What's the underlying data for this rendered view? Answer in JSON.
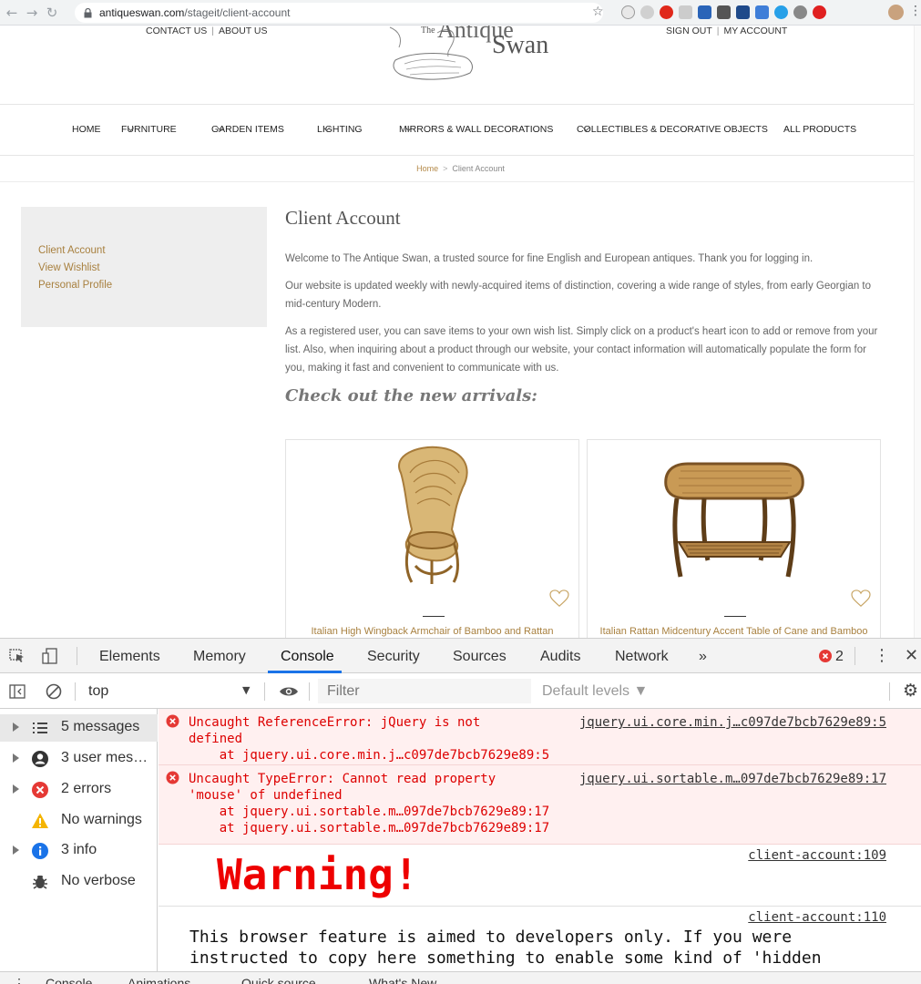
{
  "browser": {
    "url_host": "antiqueswan.com",
    "url_path": "/stageit/client-account"
  },
  "site": {
    "top_left_links": [
      "CONTACT US",
      "ABOUT US"
    ],
    "top_right_links": [
      "SIGN OUT",
      "MY ACCOUNT"
    ],
    "logo": {
      "the": "The",
      "antique": "Antique",
      "swan": "Swan"
    },
    "nav": [
      "HOME",
      "FURNITURE",
      "GARDEN ITEMS",
      "LIGHTING",
      "MIRRORS & WALL DECORATIONS",
      "COLLECTIBLES & DECORATIVE OBJECTS",
      "ALL PRODUCTS"
    ],
    "breadcrumb": {
      "home": "Home",
      "sep": ">",
      "current": "Client Account"
    },
    "sidebar": [
      "Client Account",
      "View Wishlist",
      "Personal Profile"
    ],
    "content": {
      "title": "Client Account",
      "p1": "Welcome to The Antique Swan, a trusted source for fine English and European antiques. Thank you for logging in.",
      "p2": "Our website is updated weekly with newly-acquired items of distinction, covering a wide range of styles, from early Georgian to mid-century Modern.",
      "p3": "As a registered user, you can save items to your own wish list. Simply click on a product's heart icon to add or remove from your list. Also, when inquiring about a product through our website, your contact information will automatically populate the form for you, making it fast and convenient to communicate with us.",
      "arrivals": "Check out the new arrivals:"
    },
    "products": [
      {
        "title": "Italian High Wingback Armchair of Bamboo and Rattan"
      },
      {
        "title": "Italian Rattan Midcentury Accent Table of Cane and Bamboo"
      }
    ],
    "colors": {
      "accent": "#a8803f",
      "sidebar_bg": "#eeeeee"
    }
  },
  "devtools": {
    "tabs": [
      "Elements",
      "Memory",
      "Console",
      "Security",
      "Sources",
      "Audits",
      "Network"
    ],
    "more_tabs": "»",
    "active_tab": "Console",
    "error_count": "2",
    "context": "top",
    "filter_placeholder": "Filter",
    "levels": "Default levels ▼",
    "sidebar": [
      {
        "label": "5 messages",
        "icon": "list-icon"
      },
      {
        "label": "3 user mes…",
        "icon": "user-icon"
      },
      {
        "label": "2 errors",
        "icon": "error-icon"
      },
      {
        "label": "No warnings",
        "icon": "warning-icon"
      },
      {
        "label": "3 info",
        "icon": "info-icon"
      },
      {
        "label": "No verbose",
        "icon": "bug-icon"
      }
    ],
    "messages": {
      "err1_text": "Uncaught ReferenceError: jQuery is not\ndefined\n    at jquery.ui.core.min.j…c097de7bcb7629e89:5",
      "err1_src": "jquery.ui.core.min.j…c097de7bcb7629e89:5",
      "err2_text": "Uncaught TypeError: Cannot read property\n'mouse' of undefined\n    at jquery.ui.sortable.m…097de7bcb7629e89:17\n    at jquery.ui.sortable.m…097de7bcb7629e89:17",
      "err2_src": "jquery.ui.sortable.m…097de7bcb7629e89:17",
      "warn_src": "client-account:109",
      "warn_text": "Warning!",
      "note_src": "client-account:110",
      "note_text": "This browser feature is aimed to developers only. If you were\ninstructed to copy here something to enable some kind of 'hidden"
    },
    "drawer_tabs": [
      "Console",
      "Animations",
      "Quick source",
      "What's New"
    ]
  }
}
